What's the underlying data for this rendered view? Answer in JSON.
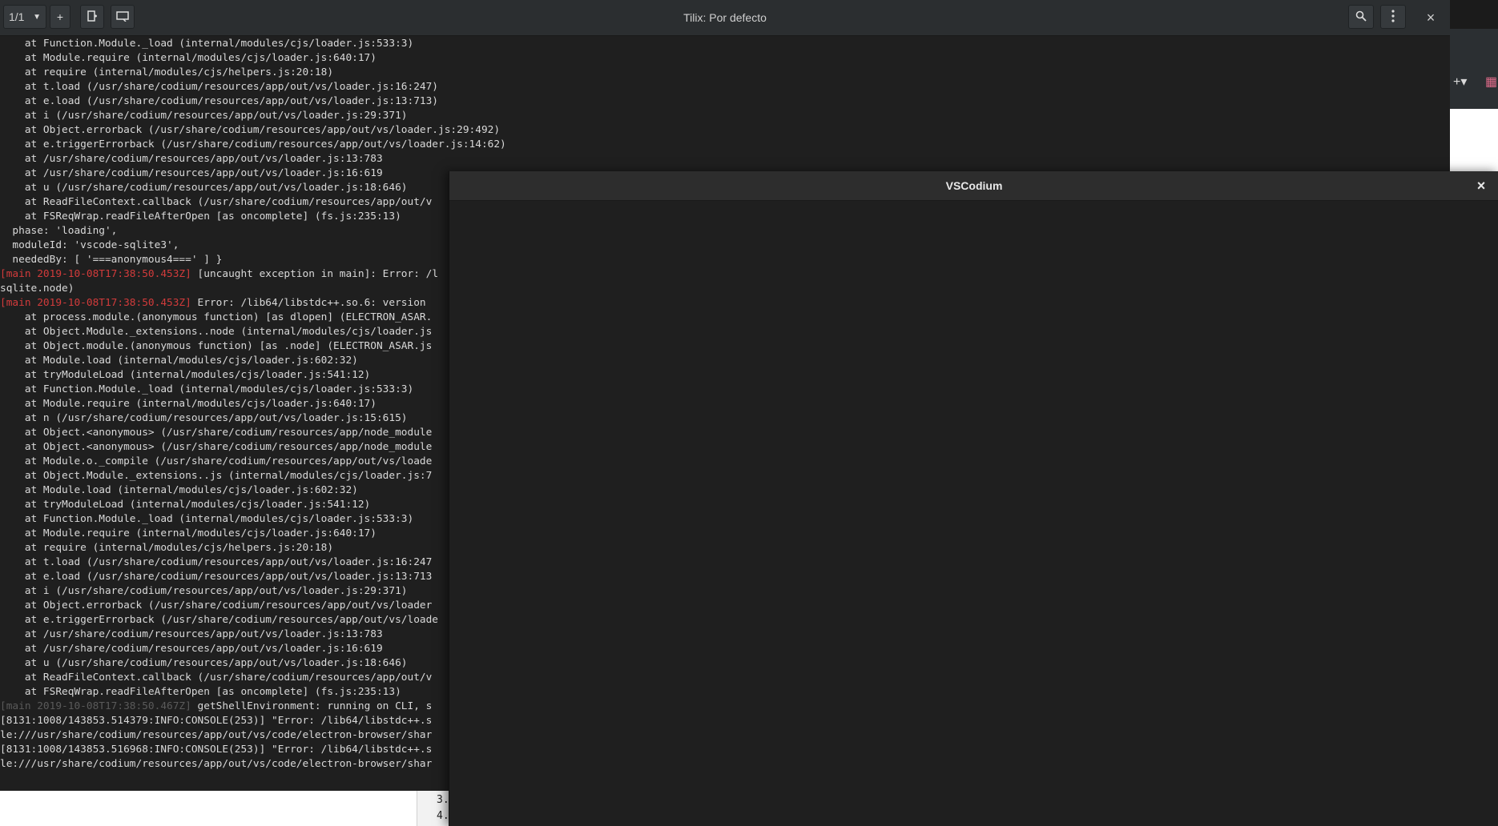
{
  "tilix": {
    "title": "Tilix: Por defecto",
    "session_label": "1/1",
    "add_label": "+",
    "close_label": "×"
  },
  "terminal": {
    "lines": [
      {
        "t": "    at Function.Module._load (internal/modules/cjs/loader.js:533:3)",
        "c": ""
      },
      {
        "t": "    at Module.require (internal/modules/cjs/loader.js:640:17)",
        "c": ""
      },
      {
        "t": "    at require (internal/modules/cjs/helpers.js:20:18)",
        "c": ""
      },
      {
        "t": "    at t.load (/usr/share/codium/resources/app/out/vs/loader.js:16:247)",
        "c": ""
      },
      {
        "t": "    at e.load (/usr/share/codium/resources/app/out/vs/loader.js:13:713)",
        "c": ""
      },
      {
        "t": "    at i (/usr/share/codium/resources/app/out/vs/loader.js:29:371)",
        "c": ""
      },
      {
        "t": "    at Object.errorback (/usr/share/codium/resources/app/out/vs/loader.js:29:492)",
        "c": ""
      },
      {
        "t": "    at e.triggerErrorback (/usr/share/codium/resources/app/out/vs/loader.js:14:62)",
        "c": ""
      },
      {
        "t": "    at /usr/share/codium/resources/app/out/vs/loader.js:13:783",
        "c": ""
      },
      {
        "t": "    at /usr/share/codium/resources/app/out/vs/loader.js:16:619",
        "c": ""
      },
      {
        "t": "    at u (/usr/share/codium/resources/app/out/vs/loader.js:18:646)",
        "c": ""
      },
      {
        "t": "    at ReadFileContext.callback (/usr/share/codium/resources/app/out/v",
        "c": ""
      },
      {
        "t": "    at FSReqWrap.readFileAfterOpen [as oncomplete] (fs.js:235:13)",
        "c": ""
      },
      {
        "t": "  phase: 'loading',",
        "c": ""
      },
      {
        "t": "  moduleId: 'vscode-sqlite3',",
        "c": ""
      },
      {
        "t": "  neededBy: [ '===anonymous4===' ] }",
        "c": ""
      },
      {
        "t": "[main 2019-10-08T17:38:50.453Z]",
        "c": "red",
        "r": " [uncaught exception in main]: Error: /l"
      },
      {
        "t": "sqlite.node)",
        "c": ""
      },
      {
        "t": "[main 2019-10-08T17:38:50.453Z]",
        "c": "red",
        "r": " Error: /lib64/libstdc++.so.6: version "
      },
      {
        "t": "    at process.module.(anonymous function) [as dlopen] (ELECTRON_ASAR.",
        "c": ""
      },
      {
        "t": "    at Object.Module._extensions..node (internal/modules/cjs/loader.js",
        "c": ""
      },
      {
        "t": "    at Object.module.(anonymous function) [as .node] (ELECTRON_ASAR.js",
        "c": ""
      },
      {
        "t": "    at Module.load (internal/modules/cjs/loader.js:602:32)",
        "c": ""
      },
      {
        "t": "    at tryModuleLoad (internal/modules/cjs/loader.js:541:12)",
        "c": ""
      },
      {
        "t": "    at Function.Module._load (internal/modules/cjs/loader.js:533:3)",
        "c": ""
      },
      {
        "t": "    at Module.require (internal/modules/cjs/loader.js:640:17)",
        "c": ""
      },
      {
        "t": "    at n (/usr/share/codium/resources/app/out/vs/loader.js:15:615)",
        "c": ""
      },
      {
        "t": "    at Object.<anonymous> (/usr/share/codium/resources/app/node_module",
        "c": ""
      },
      {
        "t": "    at Object.<anonymous> (/usr/share/codium/resources/app/node_module",
        "c": ""
      },
      {
        "t": "    at Module.o._compile (/usr/share/codium/resources/app/out/vs/loade",
        "c": ""
      },
      {
        "t": "    at Object.Module._extensions..js (internal/modules/cjs/loader.js:7",
        "c": ""
      },
      {
        "t": "    at Module.load (internal/modules/cjs/loader.js:602:32)",
        "c": ""
      },
      {
        "t": "    at tryModuleLoad (internal/modules/cjs/loader.js:541:12)",
        "c": ""
      },
      {
        "t": "    at Function.Module._load (internal/modules/cjs/loader.js:533:3)",
        "c": ""
      },
      {
        "t": "    at Module.require (internal/modules/cjs/loader.js:640:17)",
        "c": ""
      },
      {
        "t": "    at require (internal/modules/cjs/helpers.js:20:18)",
        "c": ""
      },
      {
        "t": "    at t.load (/usr/share/codium/resources/app/out/vs/loader.js:16:247",
        "c": ""
      },
      {
        "t": "    at e.load (/usr/share/codium/resources/app/out/vs/loader.js:13:713",
        "c": ""
      },
      {
        "t": "    at i (/usr/share/codium/resources/app/out/vs/loader.js:29:371)",
        "c": ""
      },
      {
        "t": "    at Object.errorback (/usr/share/codium/resources/app/out/vs/loader",
        "c": ""
      },
      {
        "t": "    at e.triggerErrorback (/usr/share/codium/resources/app/out/vs/loade",
        "c": ""
      },
      {
        "t": "    at /usr/share/codium/resources/app/out/vs/loader.js:13:783",
        "c": ""
      },
      {
        "t": "    at /usr/share/codium/resources/app/out/vs/loader.js:16:619",
        "c": ""
      },
      {
        "t": "    at u (/usr/share/codium/resources/app/out/vs/loader.js:18:646)",
        "c": ""
      },
      {
        "t": "    at ReadFileContext.callback (/usr/share/codium/resources/app/out/v",
        "c": ""
      },
      {
        "t": "    at FSReqWrap.readFileAfterOpen [as oncomplete] (fs.js:235:13)",
        "c": ""
      },
      {
        "t": "[main 2019-10-08T17:38:50.467Z]",
        "c": "dim",
        "r": " getShellEnvironment: running on CLI, s"
      },
      {
        "t": "[8131:1008/143853.514379:INFO:CONSOLE(253)] \"Error: /lib64/libstdc++.s",
        "c": ""
      },
      {
        "t": "le:///usr/share/codium/resources/app/out/vs/code/electron-browser/shar",
        "c": ""
      },
      {
        "t": "[8131:1008/143853.516968:INFO:CONSOLE(253)] \"Error: /lib64/libstdc++.s",
        "c": ""
      },
      {
        "t": "le:///usr/share/codium/resources/app/out/vs/code/electron-browser/shar",
        "c": ""
      },
      {
        "t": "",
        "c": ""
      },
      {
        "t": "_",
        "c": ""
      }
    ]
  },
  "vscodium": {
    "title": "VSCodium",
    "close_label": "×"
  },
  "background_doc": {
    "numbers": [
      "3.",
      "4."
    ]
  },
  "colors": {
    "terminal_bg": "#1f1f1f",
    "terminal_fg": "#d9d9d9",
    "error_red": "#d23b3b",
    "header_bg": "#2b2e30"
  }
}
